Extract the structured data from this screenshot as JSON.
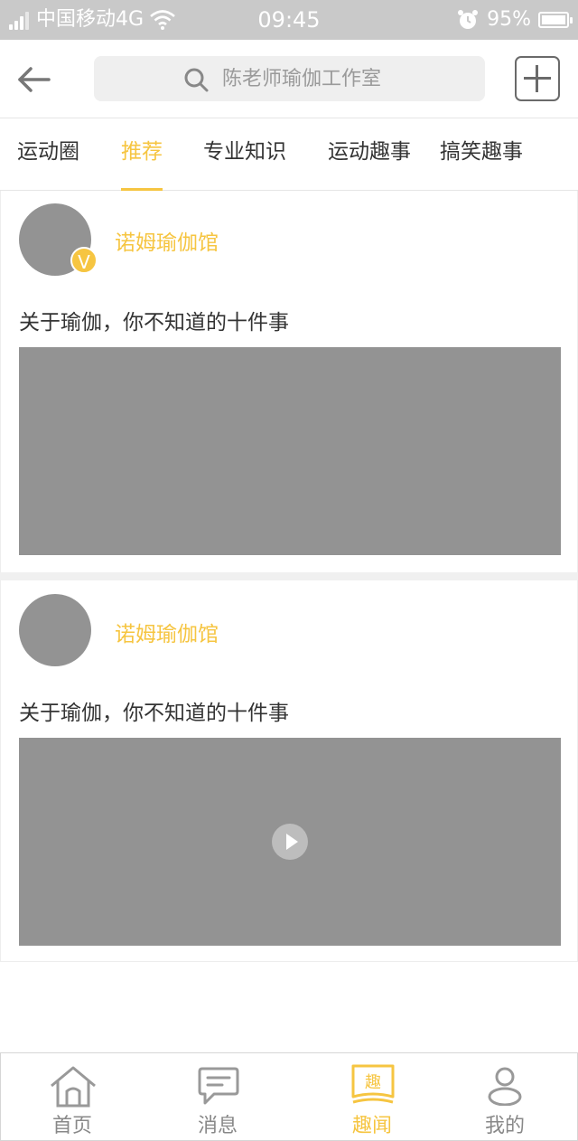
{
  "status_bar": {
    "carrier": "中国移动4G",
    "time": "09:45",
    "battery": "95%",
    "battery_level": 0.95
  },
  "header": {
    "search_placeholder": "陈老师瑜伽工作室"
  },
  "tabs": [
    {
      "label": "运动圈",
      "active": false
    },
    {
      "label": "推荐",
      "active": true
    },
    {
      "label": "专业知识",
      "active": false
    },
    {
      "label": "运动趣事",
      "active": false
    },
    {
      "label": "搞笑趣事",
      "active": false
    }
  ],
  "posts": [
    {
      "author": "诺姆瑜伽馆",
      "verified_badge": "V",
      "title": "关于瑜伽，你不知道的十件事",
      "media": "image"
    },
    {
      "author": "诺姆瑜伽馆",
      "title": "关于瑜伽，你不知道的十件事",
      "media": "video"
    }
  ],
  "bottom_nav": [
    {
      "label": "首页",
      "icon": "home-icon",
      "active": false
    },
    {
      "label": "消息",
      "icon": "message-icon",
      "active": false
    },
    {
      "label": "趣闻",
      "icon": "news-book-icon",
      "icon_text": "趣",
      "active": true
    },
    {
      "label": "我的",
      "icon": "profile-icon",
      "active": false
    }
  ],
  "colors": {
    "accent": "#f6c541",
    "status_bar": "#c9c9c9",
    "placeholder_gray": "#939393"
  }
}
